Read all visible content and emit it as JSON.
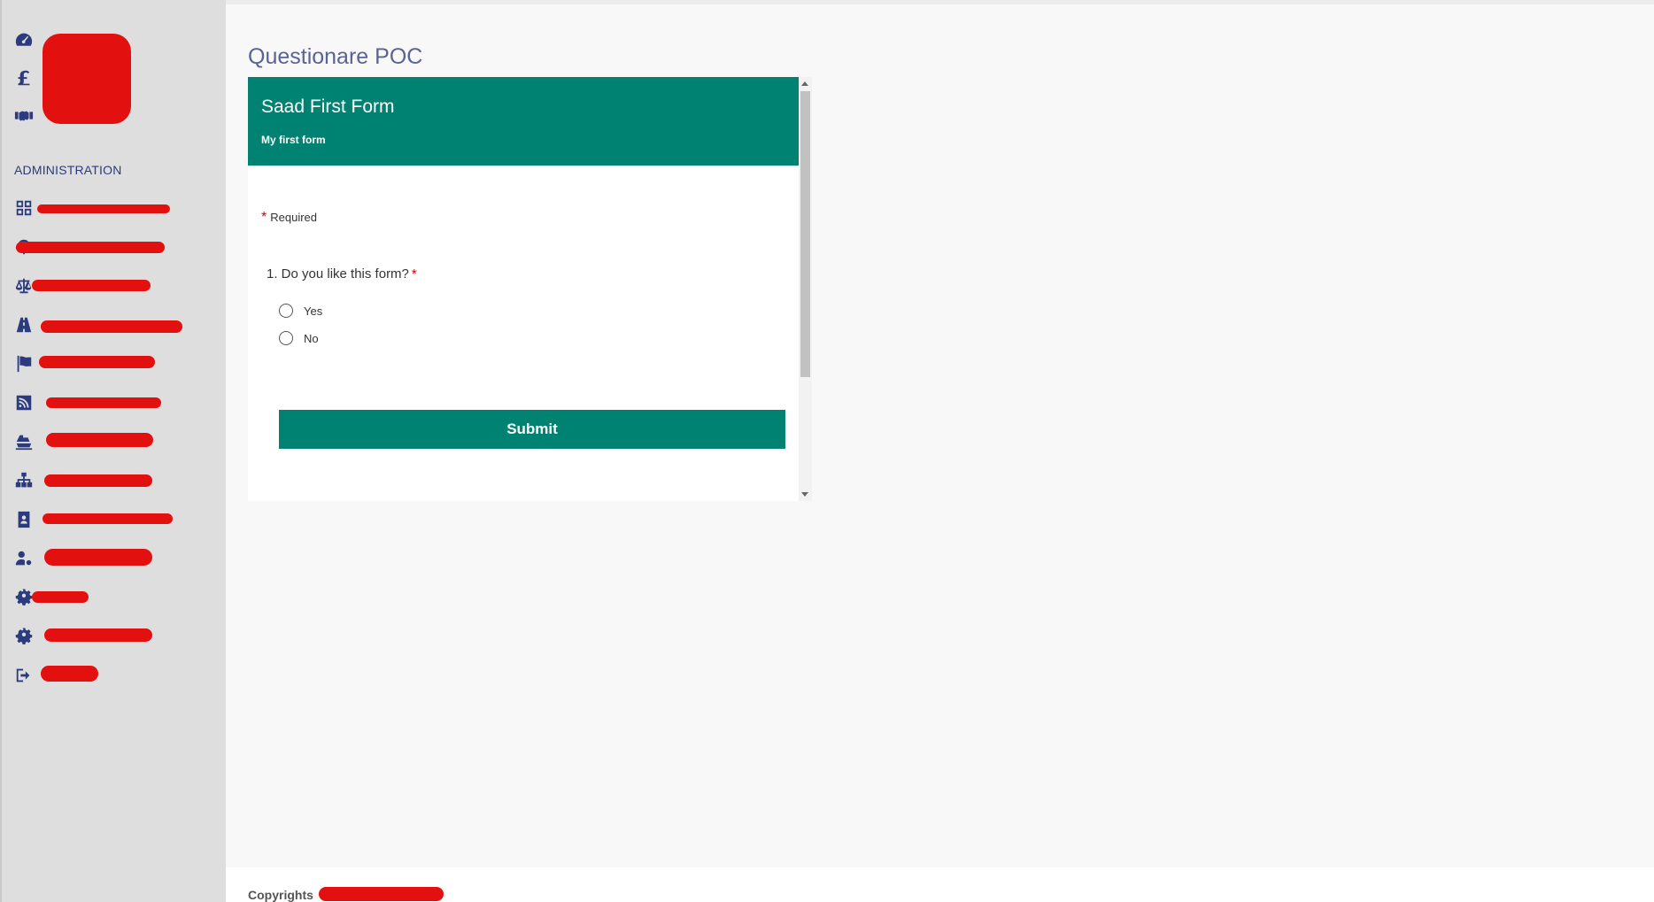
{
  "sidebar": {
    "admin_heading": "ADMINISTRATION",
    "top_icons": [
      "dashboard-icon",
      "pound-icon",
      "handshake-icon"
    ],
    "admin_icons": [
      "grid-icon",
      "tree-icon",
      "scale-icon",
      "road-icon",
      "flag-icon",
      "rss-icon",
      "ship-icon",
      "sitemap-icon",
      "address-book-icon",
      "user-cog-icon",
      "cog-icon",
      "gear-icon",
      "sign-out-icon"
    ]
  },
  "main": {
    "page_title": "Questionare POC"
  },
  "form": {
    "title": "Saad First Form",
    "description": "My first form",
    "required_star": "*",
    "required_label": "Required",
    "question": "1. Do you like this form?",
    "question_star": "*",
    "options": [
      "Yes",
      "No"
    ],
    "submit_label": "Submit",
    "accent_color": "#008272"
  },
  "footer": {
    "copyright_label": "Copyrights"
  }
}
